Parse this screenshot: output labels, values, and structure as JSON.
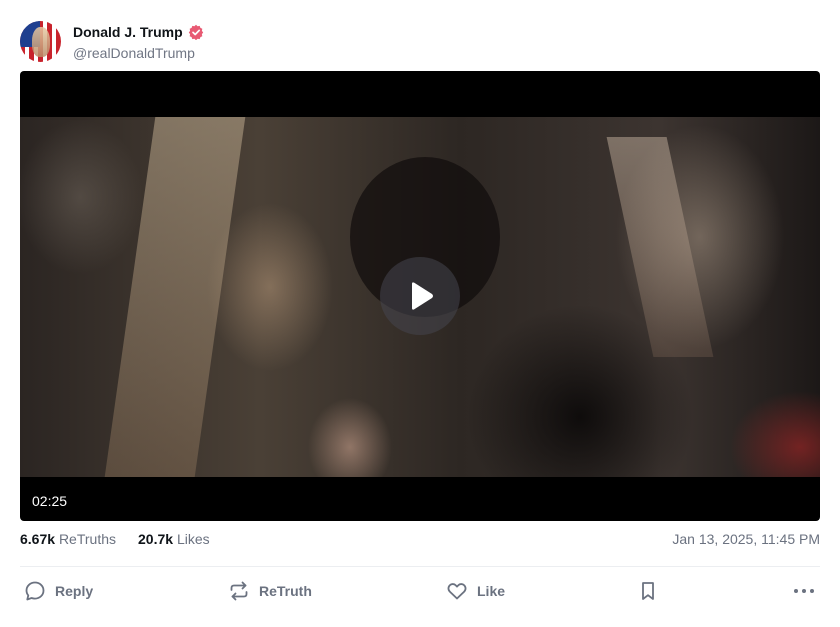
{
  "post": {
    "author_name": "Donald J. Trump",
    "author_handle": "@realDonaldTrump",
    "video_duration": "02:25",
    "stats": {
      "retruths_count": "6.67k",
      "retruths_label": "ReTruths",
      "likes_count": "20.7k",
      "likes_label": "Likes"
    },
    "timestamp": "Jan 13, 2025, 11:45 PM"
  },
  "actions": {
    "reply": "Reply",
    "retruth": "ReTruth",
    "like": "Like"
  },
  "icons": {
    "verified": "verified-badge-icon",
    "play": "play-icon",
    "reply": "speech-bubble-icon",
    "retruth": "repost-arrows-icon",
    "like": "heart-icon",
    "bookmark": "bookmark-icon",
    "more": "ellipsis-icon"
  },
  "colors": {
    "verified_badge": "#e85a73",
    "icon_gray": "#6b7280",
    "text_primary": "#0f1419"
  }
}
